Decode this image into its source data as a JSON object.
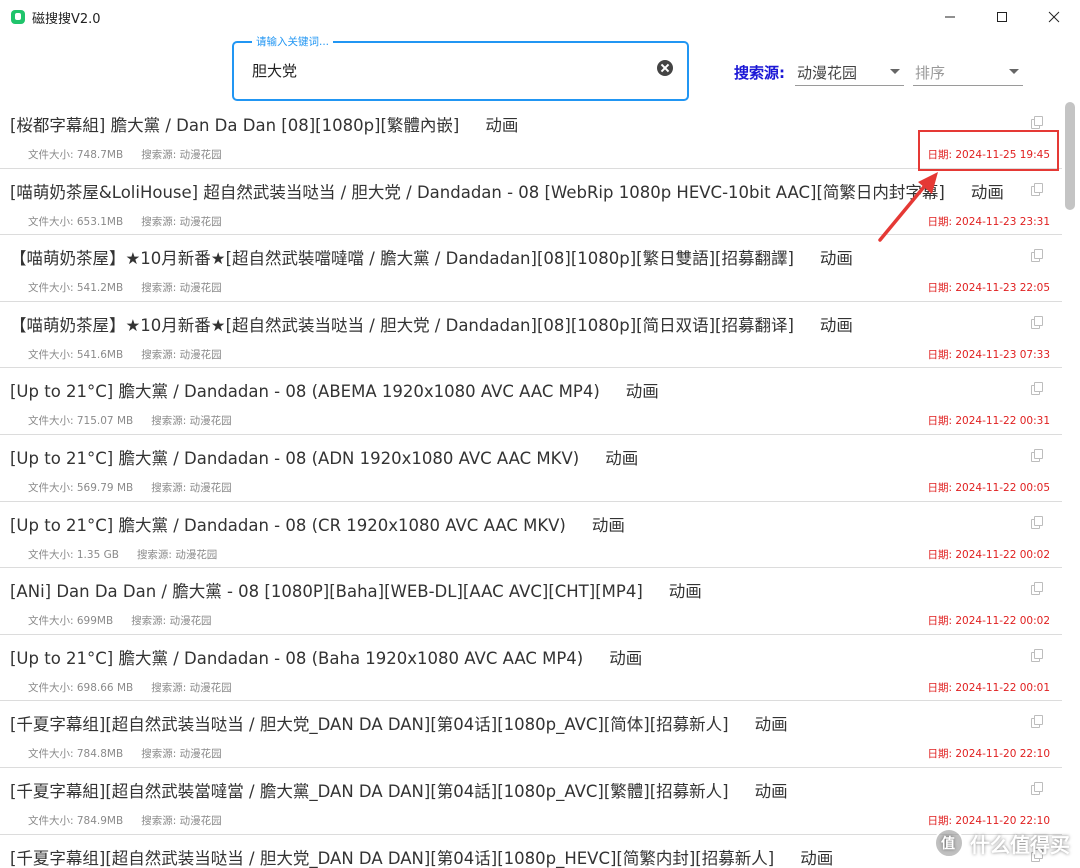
{
  "window": {
    "title": "磁搜搜V2.0"
  },
  "search": {
    "label": "请输入关键词...",
    "value": "胆大党"
  },
  "filters": {
    "source_label": "搜索源:",
    "source_value": "动漫花园",
    "sort_placeholder": "排序"
  },
  "results": [
    {
      "title": "[桜都字幕組] 膽大黨 / Dan Da Dan [08][1080p][繁體內嵌]",
      "category": "动画",
      "size": "文件大小: 748.7MB",
      "source": "搜索源: 动漫花园",
      "date": "日期: 2024-11-25 19:45"
    },
    {
      "title": "[喵萌奶茶屋&LoliHouse] 超自然武装当哒当 / 胆大党 / Dandadan - 08 [WebRip 1080p HEVC-10bit AAC][简繁日内封字幕]",
      "category": "动画",
      "size": "文件大小: 653.1MB",
      "source": "搜索源: 动漫花园",
      "date": "日期: 2024-11-23 23:31"
    },
    {
      "title": "【喵萌奶茶屋】★10月新番★[超自然武裝噹噠噹 / 膽大黨 / Dandadan][08][1080p][繁日雙語][招募翻譯]",
      "category": "动画",
      "size": "文件大小: 541.2MB",
      "source": "搜索源: 动漫花园",
      "date": "日期: 2024-11-23 22:05"
    },
    {
      "title": "【喵萌奶茶屋】★10月新番★[超自然武装当哒当 / 胆大党 / Dandadan][08][1080p][简日双语][招募翻译]",
      "category": "动画",
      "size": "文件大小: 541.6MB",
      "source": "搜索源: 动漫花园",
      "date": "日期: 2024-11-23 07:33"
    },
    {
      "title": "[Up to 21°C] 膽大黨 / Dandadan - 08 (ABEMA 1920x1080 AVC AAC MP4)",
      "category": "动画",
      "size": "文件大小: 715.07 MB",
      "source": "搜索源: 动漫花园",
      "date": "日期: 2024-11-22 00:31"
    },
    {
      "title": "[Up to 21°C] 膽大黨 / Dandadan - 08 (ADN 1920x1080 AVC AAC MKV)",
      "category": "动画",
      "size": "文件大小: 569.79 MB",
      "source": "搜索源: 动漫花园",
      "date": "日期: 2024-11-22 00:05"
    },
    {
      "title": "[Up to 21°C] 膽大黨 / Dandadan - 08 (CR 1920x1080 AVC AAC MKV)",
      "category": "动画",
      "size": "文件大小: 1.35 GB",
      "source": "搜索源: 动漫花园",
      "date": "日期: 2024-11-22 00:02"
    },
    {
      "title": "[ANi] Dan Da Dan /  膽大黨 - 08 [1080P][Baha][WEB-DL][AAC AVC][CHT][MP4]",
      "category": "动画",
      "size": "文件大小: 699MB",
      "source": "搜索源: 动漫花园",
      "date": "日期: 2024-11-22 00:02"
    },
    {
      "title": "[Up to 21°C] 膽大黨 / Dandadan - 08 (Baha 1920x1080 AVC AAC MP4)",
      "category": "动画",
      "size": "文件大小: 698.66 MB",
      "source": "搜索源: 动漫花园",
      "date": "日期: 2024-11-22 00:01"
    },
    {
      "title": "[千夏字幕组][超自然武装当哒当 / 胆大党_DAN DA DAN][第04话][1080p_AVC][简体][招募新人]",
      "category": "动画",
      "size": "文件大小: 784.8MB",
      "source": "搜索源: 动漫花园",
      "date": "日期: 2024-11-20 22:10"
    },
    {
      "title": "[千夏字幕組][超自然武裝當噠當 / 膽大黨_DAN DA DAN][第04話][1080p_AVC][繁體][招募新人]",
      "category": "动画",
      "size": "文件大小: 784.9MB",
      "source": "搜索源: 动漫花园",
      "date": "日期: 2024-11-20 22:10"
    },
    {
      "title": "[千夏字幕组][超自然武装当哒当 / 胆大党_DAN DA DAN][第04话][1080p_HEVC][简繁内封][招募新人]",
      "category": "动画",
      "size": "",
      "source": "",
      "date": ""
    }
  ],
  "watermark": {
    "text": "什么值得买"
  }
}
